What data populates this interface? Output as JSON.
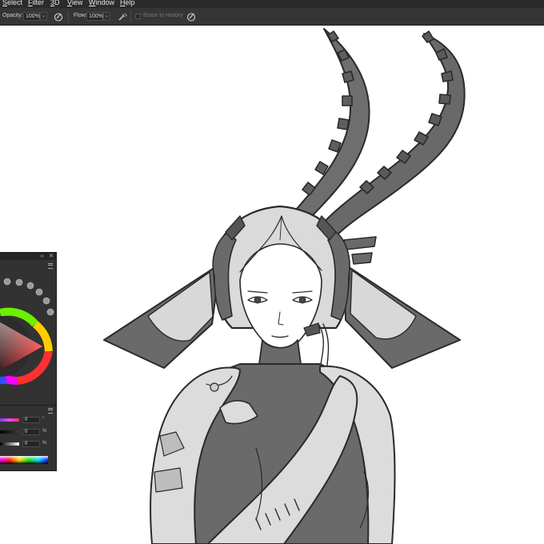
{
  "menu": [
    "Select",
    "Filter",
    "3D",
    "View",
    "Window",
    "Help"
  ],
  "options": {
    "opacity_label": "Opacity:",
    "opacity_value": "100%",
    "flow_label": "Flow:",
    "flow_value": "100%",
    "erase_to_history": "Erase to History"
  },
  "color_panel": {
    "values": [
      "0",
      "0",
      "0"
    ],
    "units": [
      "°",
      "%",
      "%"
    ],
    "collapse": "‹‹",
    "close": "✕"
  },
  "colors": {
    "ui_dark": "#2b2b2b",
    "toolbar": "#353535",
    "ink": "#2a2a2a",
    "dark_fill": "#666666",
    "light_fill": "#dcdcdc"
  }
}
